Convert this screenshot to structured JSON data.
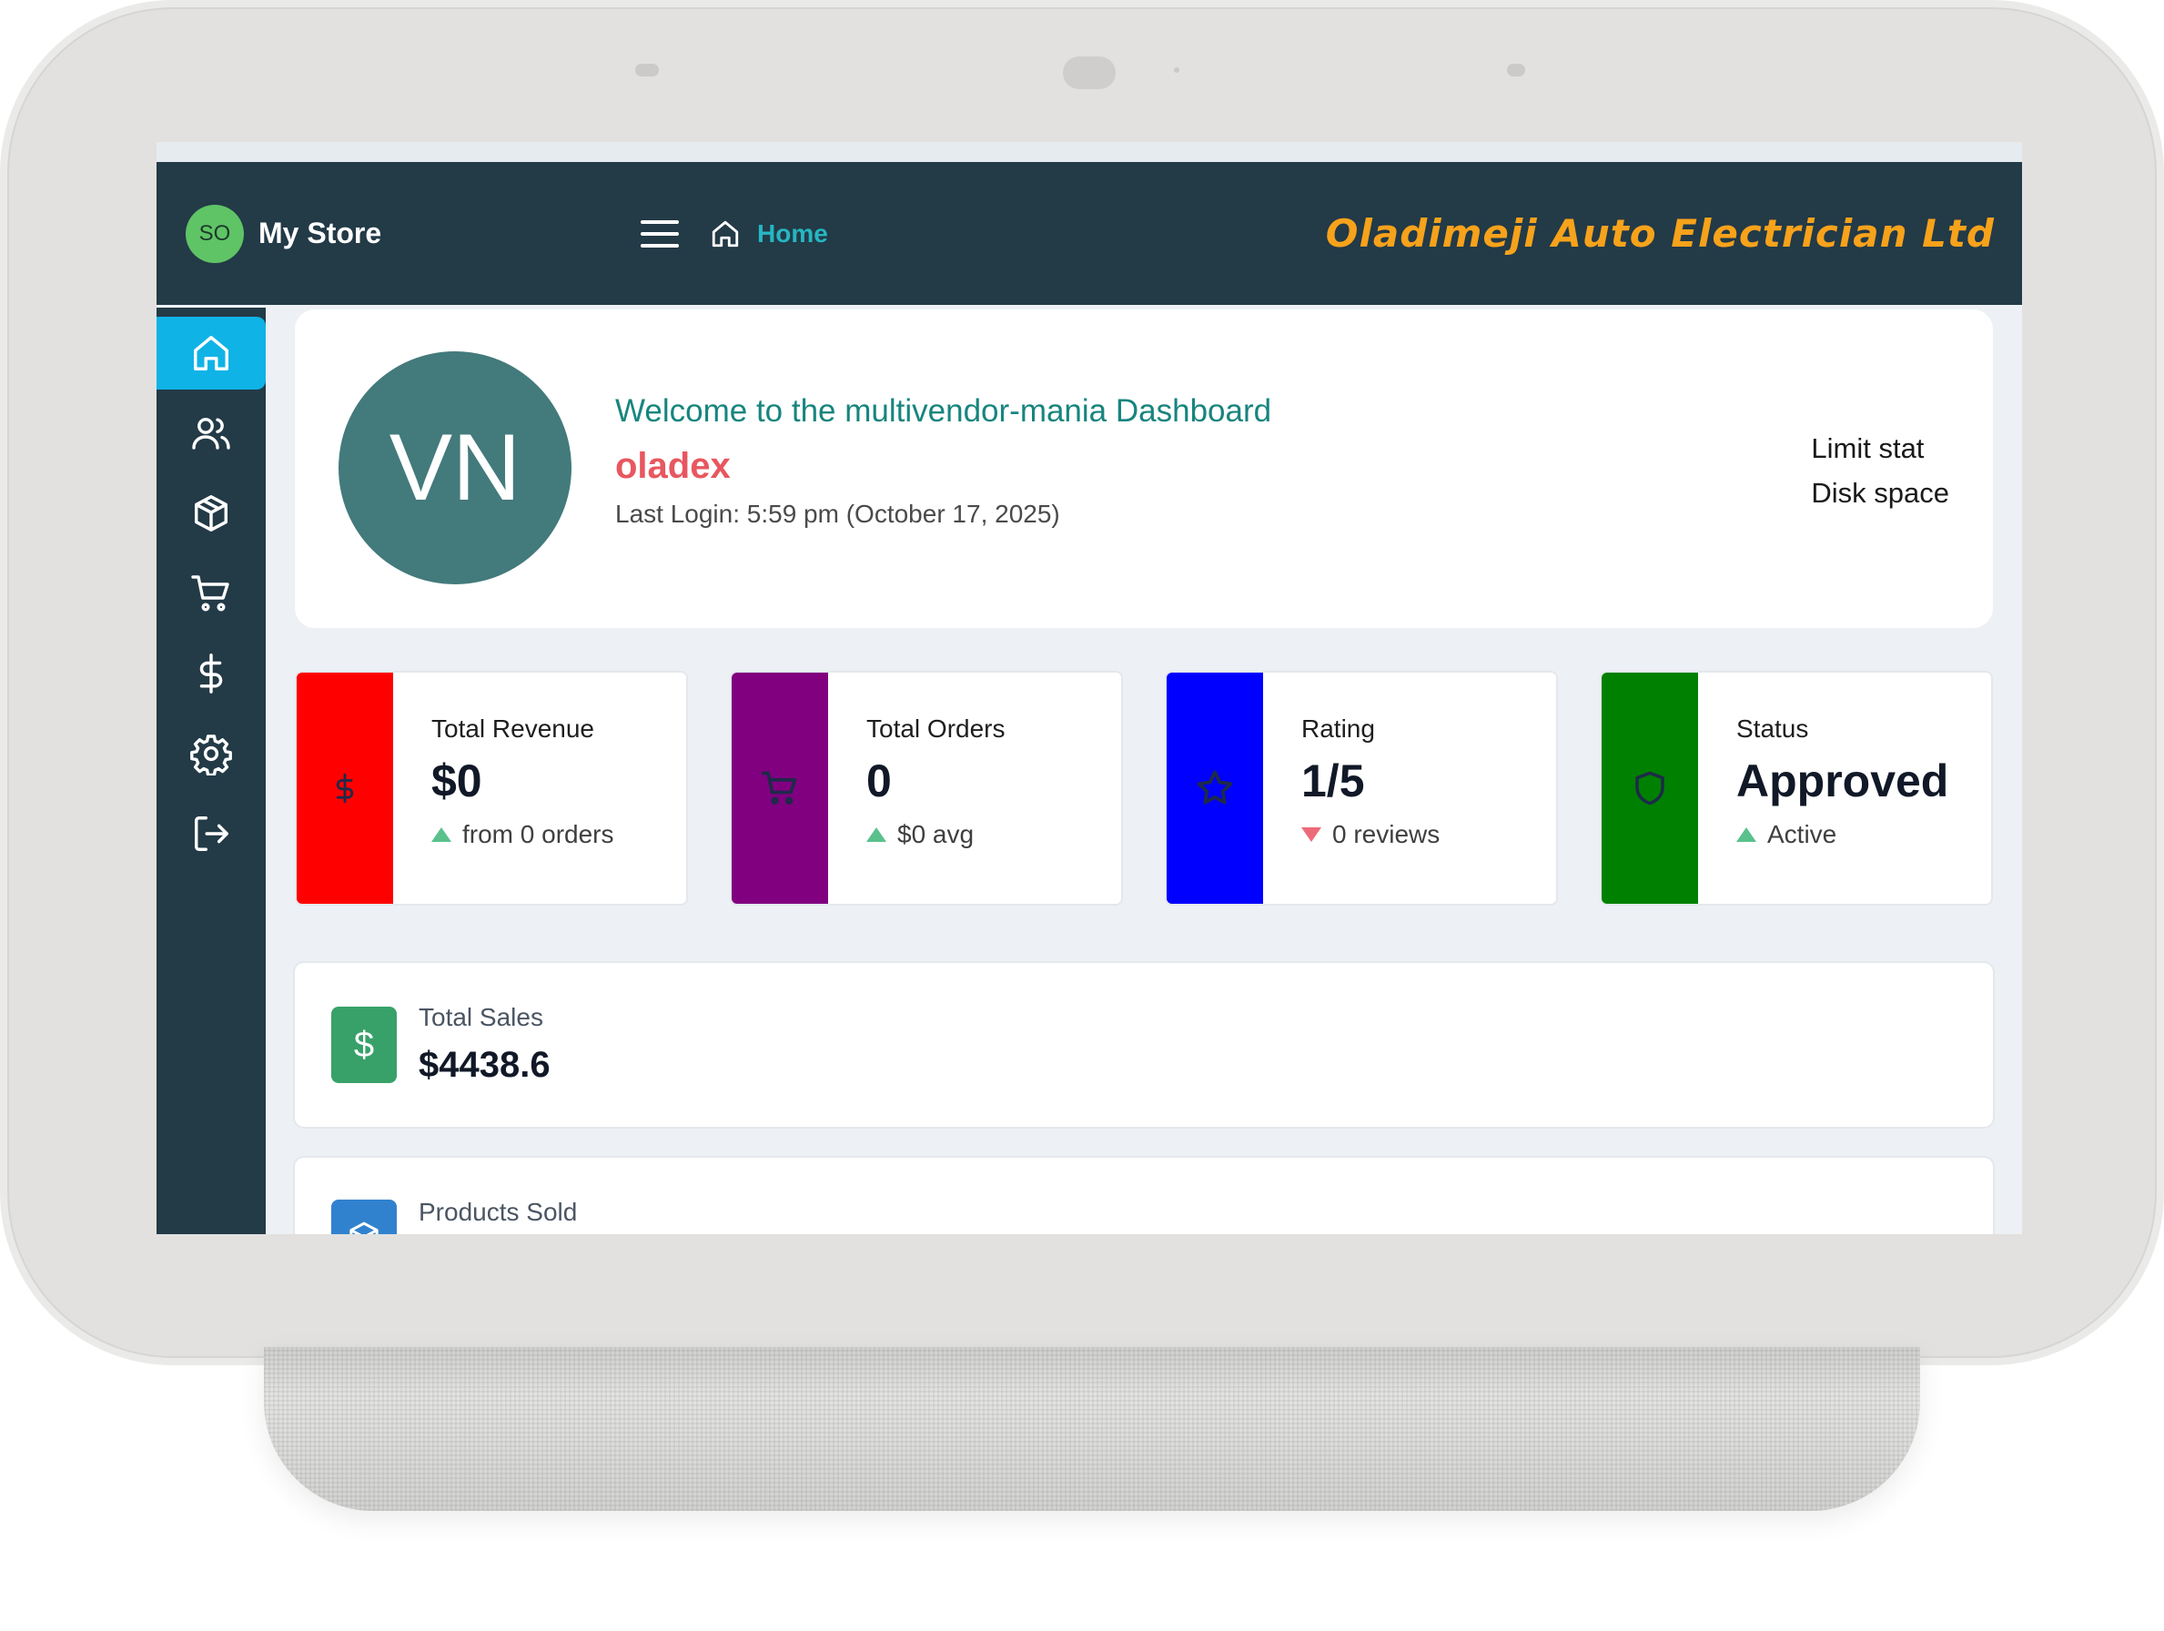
{
  "navbar": {
    "brand_initials": "SO",
    "brand_name": "My Store",
    "home_label": "Home",
    "company_name": "Oladimeji Auto Electrician Ltd"
  },
  "sidebar": {
    "items": [
      {
        "icon": "home-icon",
        "active": true
      },
      {
        "icon": "users-icon",
        "active": false
      },
      {
        "icon": "box-icon",
        "active": false
      },
      {
        "icon": "cart-icon",
        "active": false
      },
      {
        "icon": "dollar-icon",
        "active": false
      },
      {
        "icon": "gear-icon",
        "active": false
      },
      {
        "icon": "logout-icon",
        "active": false
      }
    ]
  },
  "welcome": {
    "avatar_initials": "VN",
    "message": "Welcome to the multivendor-mania Dashboard",
    "username": "oladex",
    "last_login": "Last Login: 5:59 pm (October 17, 2025)",
    "limit_stat": "Limit stat",
    "disk_space": "Disk space"
  },
  "stats": [
    {
      "label": "Total Revenue",
      "value": "$0",
      "sub": "from 0 orders",
      "trend": "up",
      "color": "#ff0000",
      "icon": "dollar-icon"
    },
    {
      "label": "Total Orders",
      "value": "0",
      "sub": "$0 avg",
      "trend": "up",
      "color": "#800080",
      "icon": "cart-icon"
    },
    {
      "label": "Rating",
      "value": "1/5",
      "sub": "0 reviews",
      "trend": "down",
      "color": "#0000ff",
      "icon": "star-icon"
    },
    {
      "label": "Status",
      "value": "Approved",
      "sub": "Active",
      "trend": "up",
      "color": "#008000",
      "icon": "shield-icon"
    }
  ],
  "summary": [
    {
      "label": "Total Sales",
      "value": "$4438.6",
      "icon": "dollar-icon",
      "color": "#38a169",
      "icon_glyph": "$"
    },
    {
      "label": "Products Sold",
      "value": "",
      "icon": "box-icon",
      "color": "#3182ce"
    }
  ]
}
